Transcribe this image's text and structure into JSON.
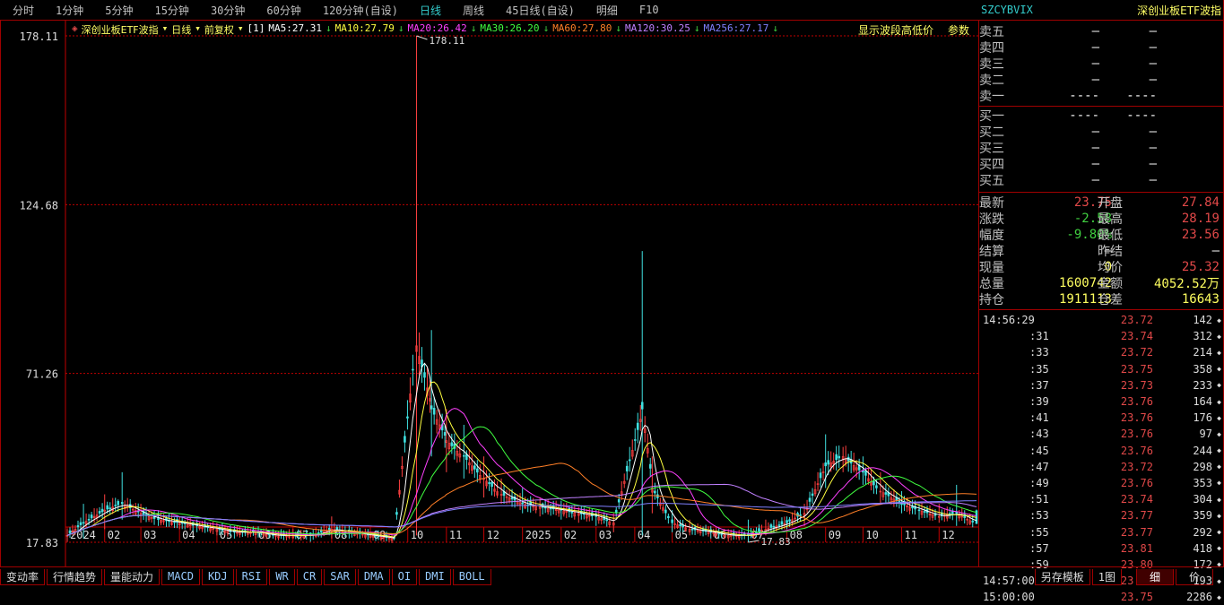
{
  "menu": [
    "分时",
    "1分钟",
    "5分钟",
    "15分钟",
    "30分钟",
    "60分钟",
    "120分钟(自设)",
    "日线",
    "周线",
    "45日线(自设)",
    "明细",
    "F10"
  ],
  "active_menu": "日线",
  "legend": {
    "name": "深创业板ETF波指",
    "period": "日线",
    "adjust": "前复权",
    "param": "[1]",
    "ma": [
      {
        "label": "MA5:27.31",
        "color": "#ffffff"
      },
      {
        "label": "MA10:27.79",
        "color": "#ffff40"
      },
      {
        "label": "MA20:26.42",
        "color": "#ff40ff"
      },
      {
        "label": "MA30:26.20",
        "color": "#40ff40"
      },
      {
        "label": "MA60:27.80",
        "color": "#ff7f27"
      },
      {
        "label": "MA120:30.25",
        "color": "#c080ff"
      },
      {
        "label": "MA256:27.17",
        "color": "#8080ff"
      }
    ]
  },
  "chart_links": [
    "显示波段高低价",
    "参数"
  ],
  "chart_data": {
    "type": "candlestick",
    "yticks": [
      "178.11",
      "124.68",
      "71.26",
      "17.83"
    ],
    "ylim": [
      17.83,
      178.11
    ],
    "high_label": "178.11",
    "low_label": "17.83",
    "xticks": [
      [
        "2024",
        "2024-01-02"
      ],
      [
        "02",
        "2024-02-01"
      ],
      [
        "03",
        "2024-03-01"
      ],
      [
        "04",
        "2024-04-01"
      ],
      [
        "05",
        "2024-05-01"
      ],
      [
        "06",
        "2024-06-01"
      ],
      [
        "07",
        "2024-07-01"
      ],
      [
        "08",
        "2024-08-01"
      ],
      [
        "09",
        "2024-09-01"
      ],
      [
        "10",
        "2024-10-01"
      ],
      [
        "11",
        "2024-11-01"
      ],
      [
        "12",
        "2024-12-01"
      ],
      [
        "2025",
        "2025-01-01"
      ],
      [
        "02",
        "2025-02-01"
      ],
      [
        "03",
        "2025-03-01"
      ],
      [
        "04",
        "2025-04-01"
      ],
      [
        "05",
        "2025-05-01"
      ],
      [
        "06",
        "2025-06-01"
      ],
      [
        "07",
        "2025-07-01"
      ],
      [
        "08",
        "2025-08-01"
      ],
      [
        "09",
        "2025-09-01"
      ],
      [
        "10",
        "2025-10-01"
      ],
      [
        "11",
        "2025-11-01"
      ],
      [
        "12",
        "2025-12-01"
      ]
    ],
    "bars": [
      [
        "2024-01-02",
        20,
        22,
        18
      ],
      [
        "2024-01-15",
        24,
        30,
        19
      ],
      [
        "2024-02-01",
        28,
        33,
        22
      ],
      [
        "2024-02-15",
        30,
        40,
        25
      ],
      [
        "2024-03-01",
        27,
        30,
        24
      ],
      [
        "2024-03-15",
        25,
        28,
        23
      ],
      [
        "2024-04-01",
        24,
        26,
        22
      ],
      [
        "2024-04-15",
        23,
        25,
        21
      ],
      [
        "2024-05-01",
        22,
        24,
        20
      ],
      [
        "2024-05-15",
        21,
        23,
        19
      ],
      [
        "2024-06-01",
        21,
        22,
        19
      ],
      [
        "2024-06-15",
        20,
        22,
        19
      ],
      [
        "2024-07-01",
        20,
        22,
        19
      ],
      [
        "2024-07-15",
        20,
        21,
        18
      ],
      [
        "2024-08-01",
        22,
        26,
        19
      ],
      [
        "2024-08-15",
        21,
        23,
        19
      ],
      [
        "2024-09-01",
        20,
        21,
        19
      ],
      [
        "2024-09-20",
        19,
        20,
        18.5
      ],
      [
        "2024-10-08",
        80,
        178.11,
        20
      ],
      [
        "2024-10-20",
        60,
        85,
        45
      ],
      [
        "2024-11-01",
        50,
        60,
        40
      ],
      [
        "2024-11-15",
        45,
        55,
        38
      ],
      [
        "2024-12-01",
        38,
        45,
        32
      ],
      [
        "2024-12-15",
        33,
        38,
        30
      ],
      [
        "2025-01-01",
        30,
        35,
        27
      ],
      [
        "2025-01-15",
        29,
        32,
        26
      ],
      [
        "2025-02-01",
        28,
        31,
        25
      ],
      [
        "2025-02-15",
        27,
        29,
        24
      ],
      [
        "2025-03-01",
        26,
        28,
        23
      ],
      [
        "2025-03-15",
        24,
        27,
        21
      ],
      [
        "2025-04-07",
        60,
        110,
        20
      ],
      [
        "2025-04-15",
        35,
        45,
        27
      ],
      [
        "2025-05-01",
        24,
        28,
        21
      ],
      [
        "2025-05-15",
        22,
        25,
        20
      ],
      [
        "2025-06-01",
        21,
        23,
        19
      ],
      [
        "2025-06-15",
        20,
        22,
        18
      ],
      [
        "2025-07-01",
        20,
        25,
        17.83
      ],
      [
        "2025-07-15",
        22,
        25,
        20
      ],
      [
        "2025-08-01",
        24,
        26,
        22
      ],
      [
        "2025-08-15",
        27,
        30,
        23
      ],
      [
        "2025-09-01",
        42,
        52,
        35
      ],
      [
        "2025-09-15",
        45,
        48,
        40
      ],
      [
        "2025-10-01",
        40,
        45,
        36
      ],
      [
        "2025-10-15",
        34,
        40,
        30
      ],
      [
        "2025-11-01",
        30,
        34,
        27
      ],
      [
        "2025-11-15",
        28,
        30,
        25
      ],
      [
        "2025-12-01",
        26,
        30,
        24
      ],
      [
        "2025-12-15",
        27,
        36,
        23
      ],
      [
        "2025-12-31",
        23.75,
        28.19,
        23.56
      ]
    ]
  },
  "bottom_tabs": [
    "变动率",
    "行情趋势",
    "量能动力",
    "MACD",
    "KDJ",
    "RSI",
    "WR",
    "CR",
    "SAR",
    "DMA",
    "OI",
    "DMI",
    "BOLL"
  ],
  "bottom_right": [
    "另存模板",
    "1图"
  ],
  "side_tabs": [
    "细",
    "价"
  ],
  "side": {
    "code": "SZCYBVIX",
    "name": "深创业板ETF波指",
    "asks": [
      [
        "卖五",
        "—",
        "—"
      ],
      [
        "卖四",
        "—",
        "—"
      ],
      [
        "卖三",
        "—",
        "—"
      ],
      [
        "卖二",
        "—",
        "—"
      ],
      [
        "卖一",
        "----",
        "----"
      ]
    ],
    "bids": [
      [
        "买一",
        "----",
        "----"
      ],
      [
        "买二",
        "—",
        "—"
      ],
      [
        "买三",
        "—",
        "—"
      ],
      [
        "买四",
        "—",
        "—"
      ],
      [
        "买五",
        "—",
        "—"
      ]
    ],
    "quote": [
      [
        "最新",
        "23.75",
        "red",
        "开盘",
        "27.84",
        "red"
      ],
      [
        "涨跌",
        "-2.58",
        "green",
        "最高",
        "28.19",
        "red"
      ],
      [
        "幅度",
        "-9.80%",
        "green",
        "最低",
        "23.56",
        "red"
      ],
      [
        "结算",
        "—",
        "",
        "昨结",
        "—",
        ""
      ],
      [
        "现量",
        "0",
        "yel",
        "均价",
        "25.32",
        "red"
      ],
      [
        "总量",
        "1600742",
        "yel",
        "金额",
        "4052.52万",
        "yel"
      ],
      [
        "持仓",
        "1911113",
        "yel",
        "仓差",
        "16643",
        "yel"
      ]
    ],
    "ticks": [
      [
        "14:56:29",
        "23.72",
        "142"
      ],
      [
        ":31",
        "23.74",
        "312"
      ],
      [
        ":33",
        "23.72",
        "214"
      ],
      [
        ":35",
        "23.75",
        "358"
      ],
      [
        ":37",
        "23.73",
        "233"
      ],
      [
        ":39",
        "23.76",
        "164"
      ],
      [
        ":41",
        "23.76",
        "176"
      ],
      [
        ":43",
        "23.76",
        "97"
      ],
      [
        ":45",
        "23.76",
        "244"
      ],
      [
        ":47",
        "23.72",
        "298"
      ],
      [
        ":49",
        "23.76",
        "353"
      ],
      [
        ":51",
        "23.74",
        "304"
      ],
      [
        ":53",
        "23.77",
        "359"
      ],
      [
        ":55",
        "23.77",
        "292"
      ],
      [
        ":57",
        "23.81",
        "418"
      ],
      [
        ":59",
        "23.80",
        "172"
      ],
      [
        "14:57:00",
        "23.80",
        "193"
      ],
      [
        "15:00:00",
        "23.75",
        "2286"
      ]
    ]
  }
}
